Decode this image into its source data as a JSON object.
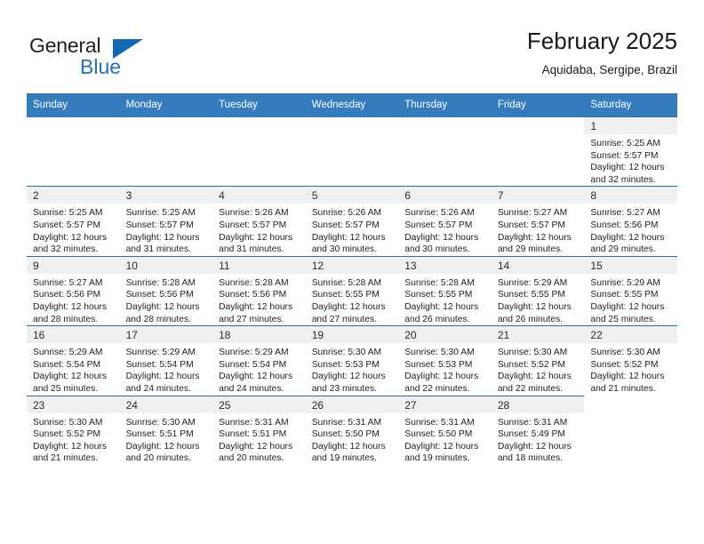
{
  "brand": {
    "name_top": "General",
    "name_bottom": "Blue",
    "triangle_color": "#1069b4",
    "blue_color": "#1f6fc0",
    "dark_color": "#231f20"
  },
  "header": {
    "title": "February 2025",
    "subtitle": "Aquidaba, Sergipe, Brazil"
  },
  "theme": {
    "header_bg": "#357cbf",
    "row_border": "#2e6da4",
    "daynum_bg": "#f0f0f0"
  },
  "weekdays": [
    "Sunday",
    "Monday",
    "Tuesday",
    "Wednesday",
    "Thursday",
    "Friday",
    "Saturday"
  ],
  "weeks": [
    [
      {
        "empty": true
      },
      {
        "empty": true
      },
      {
        "empty": true
      },
      {
        "empty": true
      },
      {
        "empty": true
      },
      {
        "empty": true
      },
      {
        "day": "1",
        "sunrise": "Sunrise: 5:25 AM",
        "sunset": "Sunset: 5:57 PM",
        "daylight_1": "Daylight: 12 hours",
        "daylight_2": "and 32 minutes."
      }
    ],
    [
      {
        "day": "2",
        "sunrise": "Sunrise: 5:25 AM",
        "sunset": "Sunset: 5:57 PM",
        "daylight_1": "Daylight: 12 hours",
        "daylight_2": "and 32 minutes."
      },
      {
        "day": "3",
        "sunrise": "Sunrise: 5:25 AM",
        "sunset": "Sunset: 5:57 PM",
        "daylight_1": "Daylight: 12 hours",
        "daylight_2": "and 31 minutes."
      },
      {
        "day": "4",
        "sunrise": "Sunrise: 5:26 AM",
        "sunset": "Sunset: 5:57 PM",
        "daylight_1": "Daylight: 12 hours",
        "daylight_2": "and 31 minutes."
      },
      {
        "day": "5",
        "sunrise": "Sunrise: 5:26 AM",
        "sunset": "Sunset: 5:57 PM",
        "daylight_1": "Daylight: 12 hours",
        "daylight_2": "and 30 minutes."
      },
      {
        "day": "6",
        "sunrise": "Sunrise: 5:26 AM",
        "sunset": "Sunset: 5:57 PM",
        "daylight_1": "Daylight: 12 hours",
        "daylight_2": "and 30 minutes."
      },
      {
        "day": "7",
        "sunrise": "Sunrise: 5:27 AM",
        "sunset": "Sunset: 5:57 PM",
        "daylight_1": "Daylight: 12 hours",
        "daylight_2": "and 29 minutes."
      },
      {
        "day": "8",
        "sunrise": "Sunrise: 5:27 AM",
        "sunset": "Sunset: 5:56 PM",
        "daylight_1": "Daylight: 12 hours",
        "daylight_2": "and 29 minutes."
      }
    ],
    [
      {
        "day": "9",
        "sunrise": "Sunrise: 5:27 AM",
        "sunset": "Sunset: 5:56 PM",
        "daylight_1": "Daylight: 12 hours",
        "daylight_2": "and 28 minutes."
      },
      {
        "day": "10",
        "sunrise": "Sunrise: 5:28 AM",
        "sunset": "Sunset: 5:56 PM",
        "daylight_1": "Daylight: 12 hours",
        "daylight_2": "and 28 minutes."
      },
      {
        "day": "11",
        "sunrise": "Sunrise: 5:28 AM",
        "sunset": "Sunset: 5:56 PM",
        "daylight_1": "Daylight: 12 hours",
        "daylight_2": "and 27 minutes."
      },
      {
        "day": "12",
        "sunrise": "Sunrise: 5:28 AM",
        "sunset": "Sunset: 5:55 PM",
        "daylight_1": "Daylight: 12 hours",
        "daylight_2": "and 27 minutes."
      },
      {
        "day": "13",
        "sunrise": "Sunrise: 5:28 AM",
        "sunset": "Sunset: 5:55 PM",
        "daylight_1": "Daylight: 12 hours",
        "daylight_2": "and 26 minutes."
      },
      {
        "day": "14",
        "sunrise": "Sunrise: 5:29 AM",
        "sunset": "Sunset: 5:55 PM",
        "daylight_1": "Daylight: 12 hours",
        "daylight_2": "and 26 minutes."
      },
      {
        "day": "15",
        "sunrise": "Sunrise: 5:29 AM",
        "sunset": "Sunset: 5:55 PM",
        "daylight_1": "Daylight: 12 hours",
        "daylight_2": "and 25 minutes."
      }
    ],
    [
      {
        "day": "16",
        "sunrise": "Sunrise: 5:29 AM",
        "sunset": "Sunset: 5:54 PM",
        "daylight_1": "Daylight: 12 hours",
        "daylight_2": "and 25 minutes."
      },
      {
        "day": "17",
        "sunrise": "Sunrise: 5:29 AM",
        "sunset": "Sunset: 5:54 PM",
        "daylight_1": "Daylight: 12 hours",
        "daylight_2": "and 24 minutes."
      },
      {
        "day": "18",
        "sunrise": "Sunrise: 5:29 AM",
        "sunset": "Sunset: 5:54 PM",
        "daylight_1": "Daylight: 12 hours",
        "daylight_2": "and 24 minutes."
      },
      {
        "day": "19",
        "sunrise": "Sunrise: 5:30 AM",
        "sunset": "Sunset: 5:53 PM",
        "daylight_1": "Daylight: 12 hours",
        "daylight_2": "and 23 minutes."
      },
      {
        "day": "20",
        "sunrise": "Sunrise: 5:30 AM",
        "sunset": "Sunset: 5:53 PM",
        "daylight_1": "Daylight: 12 hours",
        "daylight_2": "and 22 minutes."
      },
      {
        "day": "21",
        "sunrise": "Sunrise: 5:30 AM",
        "sunset": "Sunset: 5:52 PM",
        "daylight_1": "Daylight: 12 hours",
        "daylight_2": "and 22 minutes."
      },
      {
        "day": "22",
        "sunrise": "Sunrise: 5:30 AM",
        "sunset": "Sunset: 5:52 PM",
        "daylight_1": "Daylight: 12 hours",
        "daylight_2": "and 21 minutes."
      }
    ],
    [
      {
        "day": "23",
        "sunrise": "Sunrise: 5:30 AM",
        "sunset": "Sunset: 5:52 PM",
        "daylight_1": "Daylight: 12 hours",
        "daylight_2": "and 21 minutes."
      },
      {
        "day": "24",
        "sunrise": "Sunrise: 5:30 AM",
        "sunset": "Sunset: 5:51 PM",
        "daylight_1": "Daylight: 12 hours",
        "daylight_2": "and 20 minutes."
      },
      {
        "day": "25",
        "sunrise": "Sunrise: 5:31 AM",
        "sunset": "Sunset: 5:51 PM",
        "daylight_1": "Daylight: 12 hours",
        "daylight_2": "and 20 minutes."
      },
      {
        "day": "26",
        "sunrise": "Sunrise: 5:31 AM",
        "sunset": "Sunset: 5:50 PM",
        "daylight_1": "Daylight: 12 hours",
        "daylight_2": "and 19 minutes."
      },
      {
        "day": "27",
        "sunrise": "Sunrise: 5:31 AM",
        "sunset": "Sunset: 5:50 PM",
        "daylight_1": "Daylight: 12 hours",
        "daylight_2": "and 19 minutes."
      },
      {
        "day": "28",
        "sunrise": "Sunrise: 5:31 AM",
        "sunset": "Sunset: 5:49 PM",
        "daylight_1": "Daylight: 12 hours",
        "daylight_2": "and 18 minutes."
      },
      {
        "empty": true
      }
    ]
  ]
}
